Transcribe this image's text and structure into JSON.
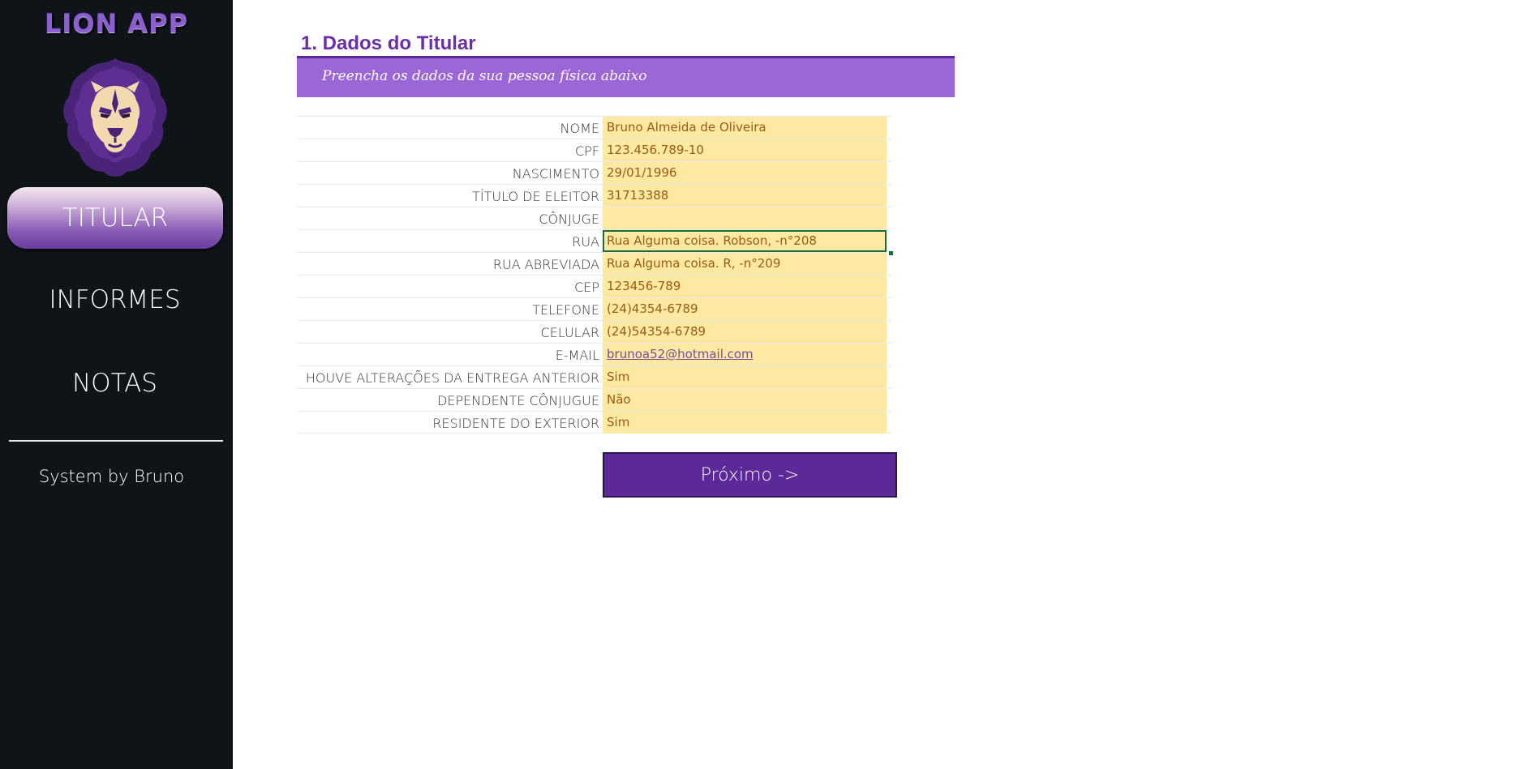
{
  "sidebar": {
    "app_title": "LION APP",
    "logo_icon": "lion-head-icon",
    "nav": [
      {
        "label": "TITULAR",
        "active": true
      },
      {
        "label": "INFORMES",
        "active": false
      },
      {
        "label": "NOTAS",
        "active": false
      }
    ],
    "footer_text": "System by Bruno"
  },
  "main": {
    "section_title": "1. Dados do Titular",
    "subtitle": "Preencha os dados da sua pessoa física abaixo",
    "fields": [
      {
        "label": "NOME",
        "value": "Bruno Almeida de Oliveira"
      },
      {
        "label": "CPF",
        "value": "123.456.789-10"
      },
      {
        "label": "NASCIMENTO",
        "value": "29/01/1996"
      },
      {
        "label": "TÍTULO DE ELEITOR",
        "value": "31713388"
      },
      {
        "label": "CÔNJUGE",
        "value": ""
      },
      {
        "label": "RUA",
        "value": "Rua Alguma coisa. Robson, -n°208",
        "selected": true
      },
      {
        "label": "RUA ABREVIADA",
        "value": "Rua Alguma coisa. R, -n°209"
      },
      {
        "label": "CEP",
        "value": "123456-789"
      },
      {
        "label": "TELEFONE",
        "value": "(24)4354-6789"
      },
      {
        "label": "CELULAR",
        "value": "(24)54354-6789"
      },
      {
        "label": "E-MAIL",
        "value": "brunoa52@hotmail.com",
        "link": true
      },
      {
        "label": "HOUVE ALTERAÇÕES DA  ENTREGA ANTERIOR",
        "value": "Sim"
      },
      {
        "label": "DEPENDENTE CÔNJUGUE",
        "value": "Não"
      },
      {
        "label": "RESIDENTE DO EXTERIOR",
        "value": "Sim"
      }
    ],
    "next_button_label": "Próximo ->"
  },
  "colors": {
    "sidebar_bg": "#0f1418",
    "accent": "#5b2a98",
    "subtitle_bar": "#9b66d6",
    "field_bg": "#fee9a2",
    "field_text": "#9a5a14"
  }
}
